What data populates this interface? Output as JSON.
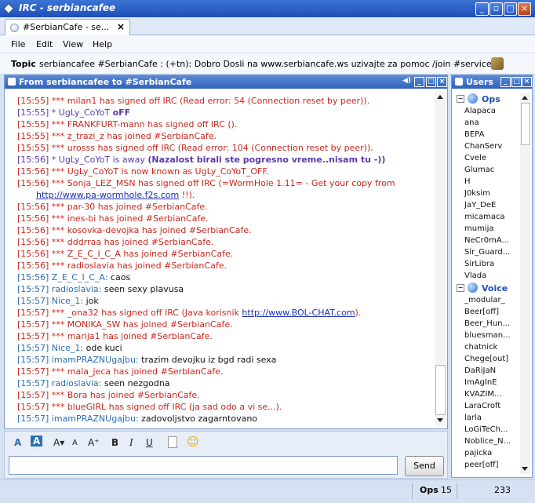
{
  "window": {
    "title": "IRC - serbiancafee"
  },
  "tab": {
    "label": "#SerbianCafe - se..."
  },
  "menu": [
    "File",
    "Edit",
    "View",
    "Help"
  ],
  "topic": {
    "label": "Topic",
    "text": "serbiancafee #SerbianCafe : (+tn): Dobro Dosli na www.serbiancafe.ws uzivajte za pomoc /join #services"
  },
  "chat": {
    "title": "From serbiancafee to #SerbianCafe",
    "messages": [
      {
        "t": "[15:55]",
        "c": "red",
        "text": " *** milan1 has signed off IRC (Read error: 54 (Connection reset by peer))."
      },
      {
        "t": "[15:55]",
        "c": "purple",
        "text": " * UgLy_CoYoT ",
        "bold": "oFF"
      },
      {
        "t": "[15:55]",
        "c": "red",
        "text": " *** FRANKFURT-mann has signed off IRC ()."
      },
      {
        "t": "[15:55]",
        "c": "red",
        "text": " *** z_trazi_z has joined #SerbianCafe."
      },
      {
        "t": "[15:55]",
        "c": "red",
        "text": " *** urosss has signed off IRC (Read error: 104 (Connection reset by peer))."
      },
      {
        "t": "[15:56]",
        "c": "purple",
        "text": " * UgLy_CoYoT is away ",
        "bold": "(Nazalost birali ste pogresno vreme..nisam tu -))"
      },
      {
        "t": "[15:56]",
        "c": "red",
        "text": " *** UgLy_CoYoT is now known as UgLy_CoYoT_OFF."
      },
      {
        "t": "[15:56]",
        "c": "red",
        "text": " *** Sonja_LEZ_MSN has signed off IRC (=WormHole 1.11= - Get your copy from"
      },
      {
        "t": "",
        "c": "red",
        "indent": true,
        "link": "http://www.pa-wormhole.f2s.com",
        "after": " !!)."
      },
      {
        "t": "[15:56]",
        "c": "red",
        "text": " *** par-30 has joined #SerbianCafe."
      },
      {
        "t": "[15:56]",
        "c": "red",
        "text": " *** ines-bi has joined #SerbianCafe."
      },
      {
        "t": "[15:56]",
        "c": "red",
        "text": " *** kosovka-devojka has joined #SerbianCafe."
      },
      {
        "t": "[15:56]",
        "c": "red",
        "text": " *** dddrraa has joined #SerbianCafe."
      },
      {
        "t": "[15:56]",
        "c": "red",
        "text": " *** Z_E_C_I_C_A has joined #SerbianCafe."
      },
      {
        "t": "[15:56]",
        "c": "red",
        "text": " *** radioslavia has joined #SerbianCafe."
      },
      {
        "t": "[15:56]",
        "c": "blue",
        "nick": " Z_E_C_I_C_A:",
        "say": " caos"
      },
      {
        "t": "[15:57]",
        "c": "blue",
        "nick": " radioslavia:",
        "say": " seen sexy plavusa"
      },
      {
        "t": "[15:57]",
        "c": "blue",
        "nick": " Nice_1:",
        "say": " jok"
      },
      {
        "t": "[15:57]",
        "c": "red",
        "text": " *** _ona32 has signed off IRC (Java korisnik ",
        "link": "http://www.BOL-CHAT.com",
        "after": ")."
      },
      {
        "t": "[15:57]",
        "c": "red",
        "text": " *** MONIKA_SW has joined #SerbianCafe."
      },
      {
        "t": "[15:57]",
        "c": "red",
        "text": " *** marija1 has joined #SerbianCafe."
      },
      {
        "t": "[15:57]",
        "c": "blue",
        "nick": " Nice_1:",
        "say": " ode kuci"
      },
      {
        "t": "[15:57]",
        "c": "blue",
        "nick": " imamPRAZNUgajbu:",
        "say": " trazim devojku iz bgd radi sexa"
      },
      {
        "t": "[15:57]",
        "c": "red",
        "text": " *** mala_jeca has joined #SerbianCafe."
      },
      {
        "t": "[15:57]",
        "c": "blue",
        "nick": " radioslavia:",
        "say": " seen nezgodna"
      },
      {
        "t": "[15:57]",
        "c": "red",
        "text": " *** Bora has joined #SerbianCafe."
      },
      {
        "t": "[15:57]",
        "c": "red",
        "text": " *** blueGIRL has signed off IRC (ja sad odo a vi se...)."
      },
      {
        "t": "[15:57]",
        "c": "blue",
        "nick": " imamPRAZNUgajbu:",
        "say": " zadovoljstvo zagarntovano"
      }
    ]
  },
  "compose": {
    "send_label": "Send"
  },
  "users": {
    "title": "Users",
    "ops_label": "Ops",
    "ops": [
      "Alapaca",
      "ana",
      "BEPA",
      "ChanServ",
      "Cvele",
      "Glumac",
      "H",
      "J0ksim",
      "JaY_DeE",
      "micamaca",
      "mumija",
      "NeCr0mA...",
      "Sir_Guard...",
      "SirLibra",
      "Vlada"
    ],
    "voice_label": "Voice",
    "voice": [
      "_modular_",
      "Beer[off]",
      "Beer_Hun...",
      "bluesman...",
      "chatnick",
      "Chege[out]",
      "DaRiJaN",
      "ImAgInE",
      "KVAZIM...",
      "LaraCroft",
      "larla",
      "LoGiTeCh...",
      "Noblice_N...",
      "pajicka",
      "peer[off]"
    ]
  },
  "status": {
    "ops_label": "Ops",
    "ops_count": "15",
    "total": "233"
  },
  "colors": {
    "red": "#c8281e",
    "purple": "#5a3aa8",
    "blue": "#2c6fb0",
    "title_blue": "#1d4fb8"
  }
}
